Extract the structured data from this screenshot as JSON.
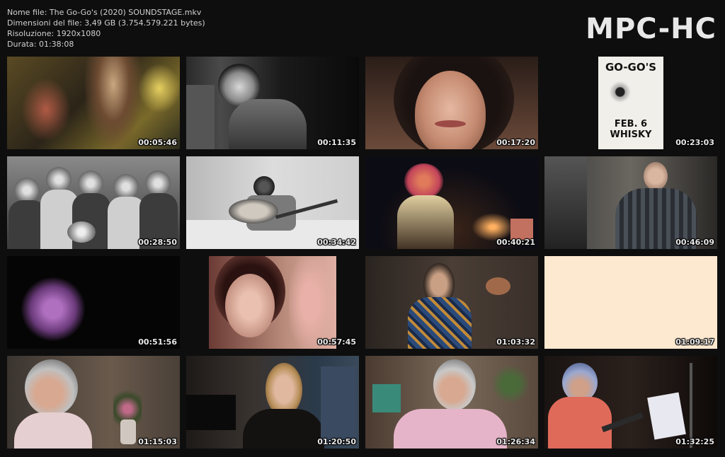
{
  "header": {
    "file_name": "Nome file: The Go-Go's (2020) SOUNDSTAGE.mkv",
    "file_size": "Dimensioni del file: 3,49 GB (3.754.579.221 bytes)",
    "resolution": "Risoluzione: 1920x1080",
    "duration": "Durata: 01:38:08",
    "logo": "MPC-HC"
  },
  "thumbnails": [
    {
      "time": "00:05:46",
      "poster_top": "",
      "poster_bottom": "",
      "scene": "concert-grainy"
    },
    {
      "time": "00:11:35",
      "poster_top": "",
      "poster_bottom": "",
      "scene": "bw-portrait"
    },
    {
      "time": "00:17:20",
      "poster_top": "",
      "poster_bottom": "",
      "scene": "closeup-face"
    },
    {
      "time": "00:23:03",
      "poster_top": "GO-GO'S",
      "poster_bottom": "FEB. 6\nWHISKY",
      "scene": "poster"
    },
    {
      "time": "00:28:50",
      "poster_top": "",
      "poster_bottom": "",
      "scene": "bw-group"
    },
    {
      "time": "00:34:42",
      "poster_top": "",
      "poster_bottom": "",
      "scene": "bw-guitar"
    },
    {
      "time": "00:40:21",
      "poster_top": "",
      "poster_bottom": "",
      "scene": "stage-singer"
    },
    {
      "time": "00:46:09",
      "poster_top": "",
      "poster_bottom": "",
      "scene": "interview-man"
    },
    {
      "time": "00:51:56",
      "poster_top": "",
      "poster_bottom": "",
      "scene": "dark-purple"
    },
    {
      "time": "00:57:45",
      "poster_top": "",
      "poster_bottom": "",
      "scene": "video-face"
    },
    {
      "time": "01:03:32",
      "poster_top": "",
      "poster_bottom": "",
      "scene": "interview-woman"
    },
    {
      "time": "01:09:17",
      "poster_top": "",
      "poster_bottom": "",
      "scene": "blank-cream"
    },
    {
      "time": "01:15:03",
      "poster_top": "",
      "poster_bottom": "",
      "scene": "interview-silver"
    },
    {
      "time": "01:20:50",
      "poster_top": "",
      "poster_bottom": "",
      "scene": "interview-blonde"
    },
    {
      "time": "01:26:34",
      "poster_top": "",
      "poster_bottom": "",
      "scene": "interview-silver-pink"
    },
    {
      "time": "01:32:25",
      "poster_top": "",
      "poster_bottom": "",
      "scene": "performer-guitar"
    }
  ]
}
